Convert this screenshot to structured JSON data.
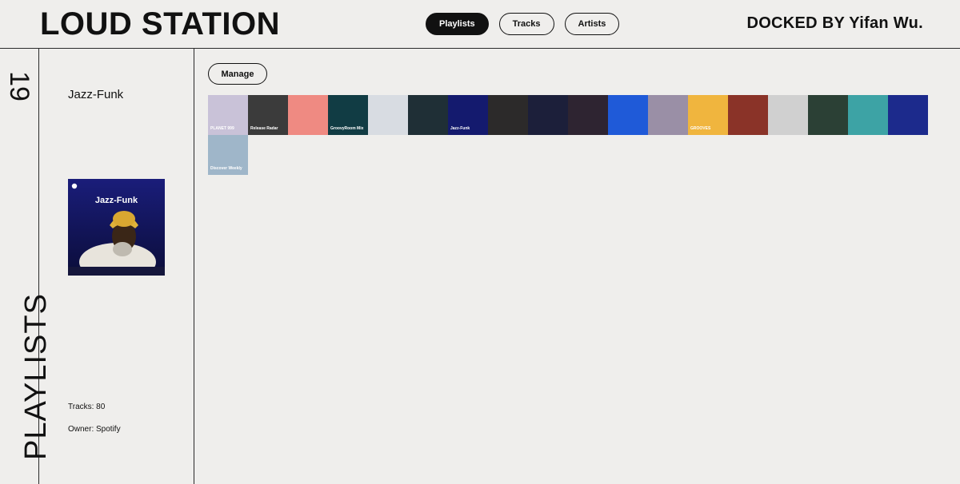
{
  "header": {
    "logo": "LOUD STATION",
    "tabs": [
      {
        "label": "Playlists",
        "active": true
      },
      {
        "label": "Tracks",
        "active": false
      },
      {
        "label": "Artists",
        "active": false
      }
    ],
    "docked_by": "DOCKED BY Yifan Wu."
  },
  "rail": {
    "count": "19",
    "title": "PLAYLISTS"
  },
  "detail": {
    "name": "Jazz-Funk",
    "cover_title": "Jazz-Funk",
    "tracks": "Tracks: 80",
    "owner": "Owner: Spotify"
  },
  "main": {
    "manage_label": "Manage"
  },
  "playlists": [
    {
      "bg": "#c9c2d8",
      "label": "PLANET 999",
      "label_color": "#ffffff"
    },
    {
      "bg": "#3b3b3b",
      "label": "Release Radar",
      "label_color": "#ffffff"
    },
    {
      "bg": "#ef8a82",
      "label": "",
      "label_color": "#ffffff"
    },
    {
      "bg": "#113c44",
      "label": "GroovyRoom Mix",
      "label_color": "#ffffff"
    },
    {
      "bg": "#d8dce2",
      "label": "",
      "label_color": "#ffffff"
    },
    {
      "bg": "#1f2f36",
      "label": "",
      "label_color": "#ffffff"
    },
    {
      "bg": "#141a6e",
      "label": "Jazz-Funk",
      "label_color": "#ffffff"
    },
    {
      "bg": "#2c2a2a",
      "label": "",
      "label_color": "#ffffff"
    },
    {
      "bg": "#1c1f3a",
      "label": "",
      "label_color": "#ffffff"
    },
    {
      "bg": "#2e2431",
      "label": "",
      "label_color": "#ffffff"
    },
    {
      "bg": "#1f5ad8",
      "label": "",
      "label_color": "#ffffff"
    },
    {
      "bg": "#9a8fa6",
      "label": "",
      "label_color": "#ffffff"
    },
    {
      "bg": "#f0b53e",
      "label": "GROOVES",
      "label_color": "#ffffff"
    },
    {
      "bg": "#8a3328",
      "label": "",
      "label_color": "#ffffff"
    },
    {
      "bg": "#d0d0d0",
      "label": "",
      "label_color": "#ffffff"
    },
    {
      "bg": "#2b4035",
      "label": "",
      "label_color": "#ffffff"
    },
    {
      "bg": "#3da3a5",
      "label": "",
      "label_color": "#ffffff"
    },
    {
      "bg": "#1c2a8c",
      "label": "",
      "label_color": "#ffffff"
    },
    {
      "bg": "#9fb6c9",
      "label": "Discover Weekly",
      "label_color": "#ffffff"
    }
  ]
}
